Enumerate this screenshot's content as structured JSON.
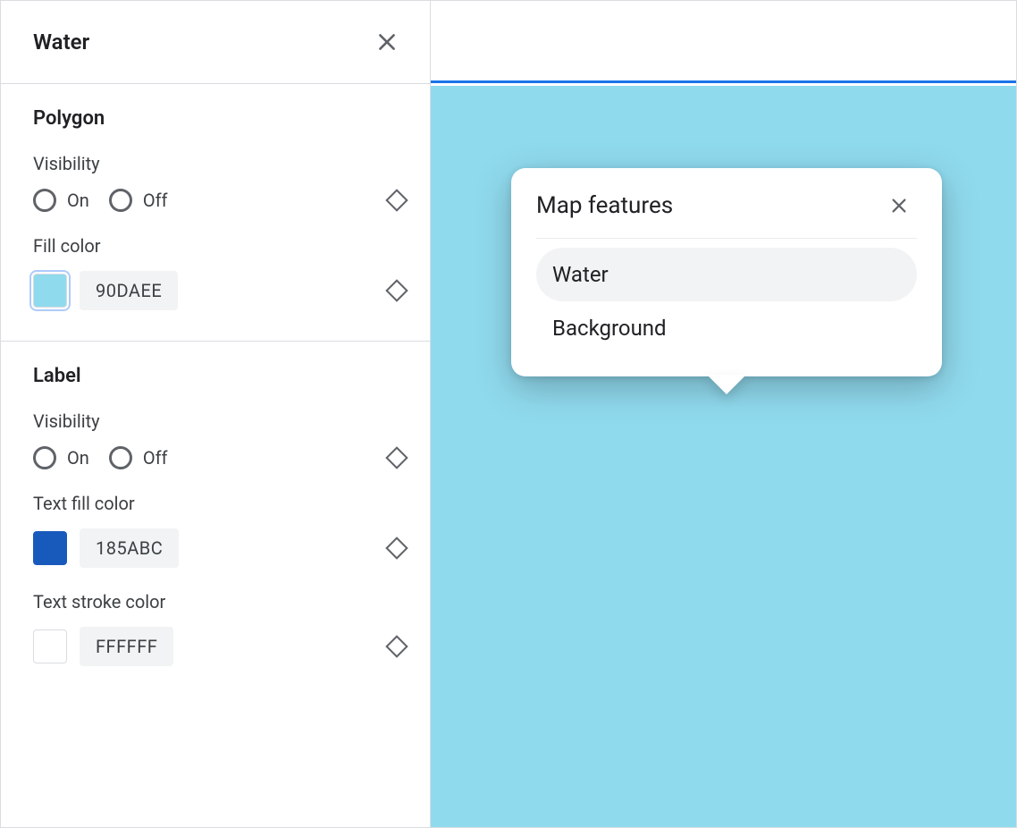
{
  "sidebar": {
    "title": "Water",
    "sections": {
      "polygon": {
        "title": "Polygon",
        "visibility_label": "Visibility",
        "radio_on": "On",
        "radio_off": "Off",
        "fill_color_label": "Fill color",
        "fill_hex": "90DAEE",
        "fill_swatch": "#90DAEE"
      },
      "label": {
        "title": "Label",
        "visibility_label": "Visibility",
        "radio_on": "On",
        "radio_off": "Off",
        "text_fill_label": "Text fill color",
        "text_fill_hex": "185ABC",
        "text_fill_swatch": "#185ABC",
        "text_stroke_label": "Text stroke color",
        "text_stroke_hex": "FFFFFF",
        "text_stroke_swatch": "#FFFFFF"
      }
    }
  },
  "preview": {
    "water_color": "#90DAEE",
    "accent_bar": "#1a73e8"
  },
  "popover": {
    "title": "Map features",
    "items": [
      {
        "label": "Water",
        "selected": true
      },
      {
        "label": "Background",
        "selected": false
      }
    ]
  }
}
